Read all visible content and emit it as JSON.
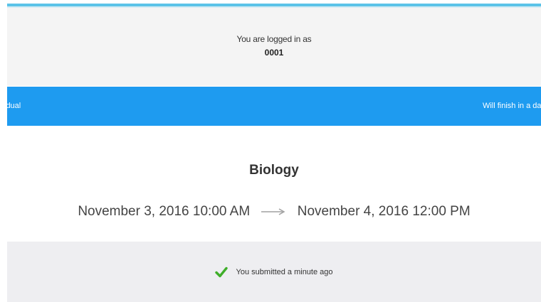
{
  "login": {
    "label": "You are logged in as",
    "user_id": "0001"
  },
  "status_bar": {
    "left_text": "idual",
    "right_text": "Will finish in a day",
    "color": "#1e9bf0"
  },
  "exam": {
    "title": "Biology",
    "start": "November 3, 2016 10:00 AM",
    "end": "November 4, 2016 12:00 PM"
  },
  "submission": {
    "text": "You submitted a minute ago",
    "icon": "check-icon",
    "icon_color": "#3fae2a"
  },
  "colors": {
    "accent": "#5bc3e8",
    "panel_bg": "#f4f4f4",
    "submission_bg": "#eeeef1"
  }
}
